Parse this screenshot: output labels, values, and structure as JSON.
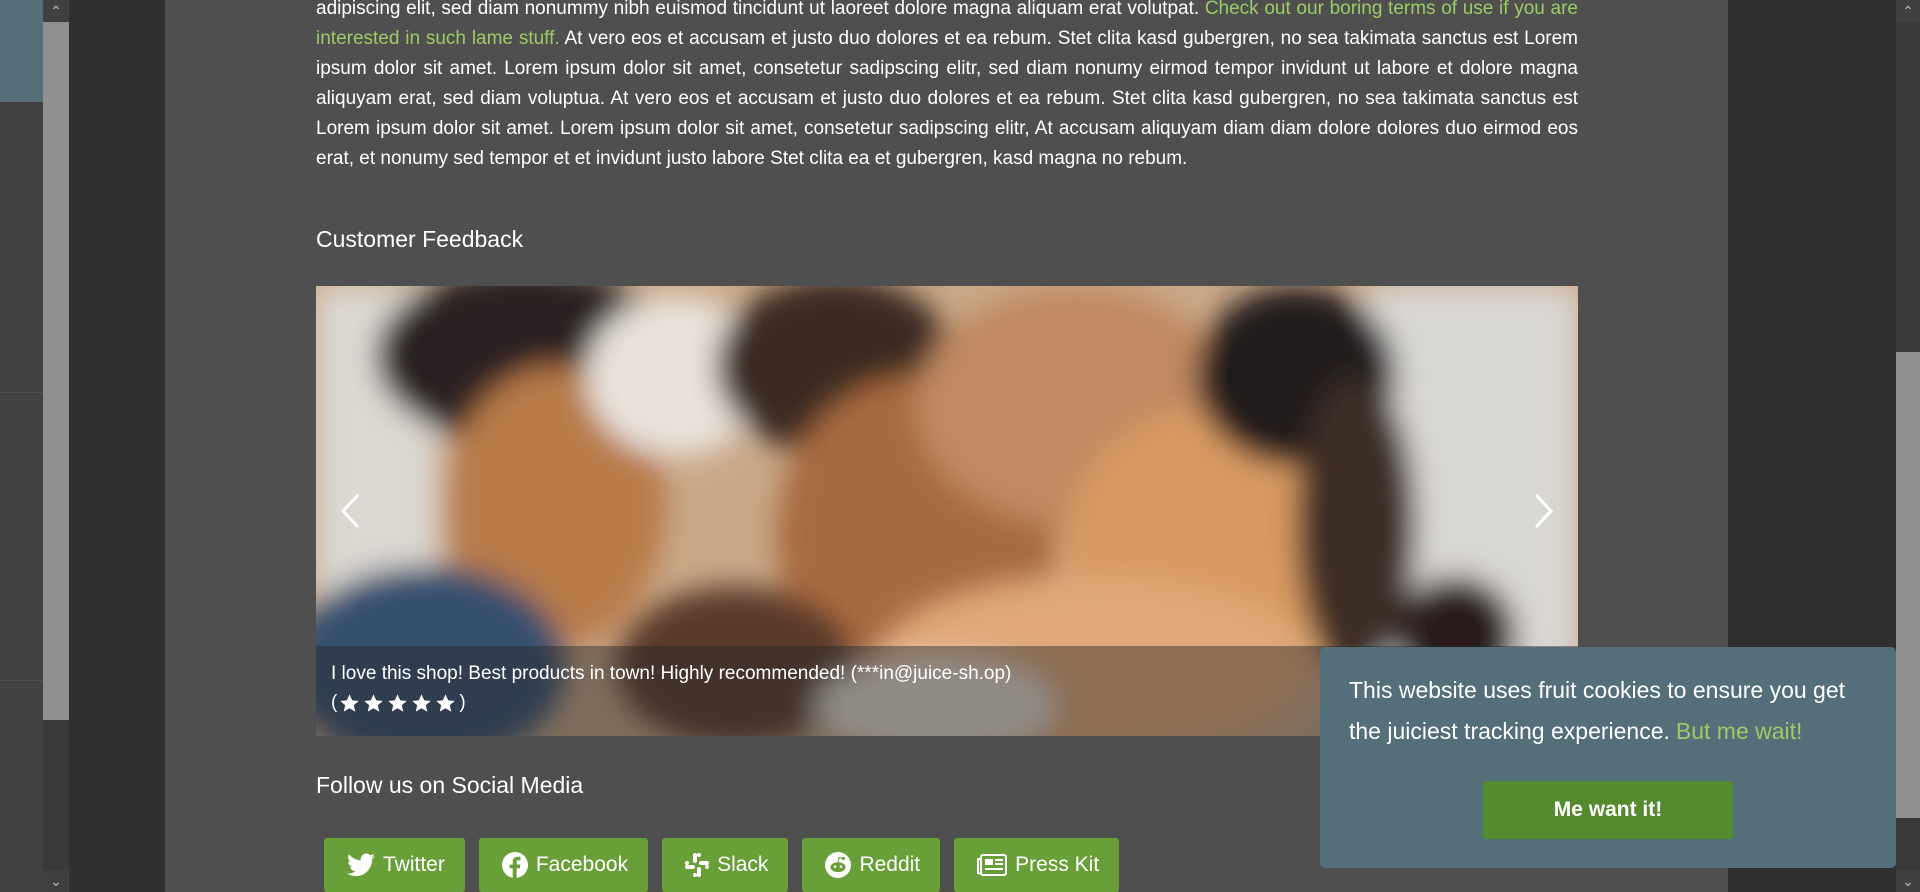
{
  "about": {
    "paragraph_start": "adipiscing elit, sed diam nonummy nibh euismod tincidunt ut laoreet dolore magna aliquam erat volutpat.",
    "terms_link": "Check out our boring terms of use if you are interested in such lame stuff.",
    "paragraph_end": "At vero eos et accusam et justo duo dolores et ea rebum. Stet clita kasd gubergren, no sea takimata sanctus est Lorem ipsum dolor sit amet. Lorem ipsum dolor sit amet, consetetur sadipscing elitr, sed diam nonumy eirmod tempor invidunt ut labore et dolore magna aliquyam erat, sed diam voluptua. At vero eos et accusam et justo duo dolores et ea rebum. Stet clita kasd gubergren, no sea takimata sanctus est Lorem ipsum dolor sit amet. Lorem ipsum dolor sit amet, consetetur sadipscing elitr, At accusam aliquyam diam diam dolore dolores duo eirmod eos erat, et nonumy sed tempor et et invidunt justo labore Stet clita ea et gubergren, kasd magna no rebum."
  },
  "feedback": {
    "title": "Customer Feedback",
    "caption": "I love this shop! Best products in town! Highly recommended! (***in@juice-sh.op)",
    "rating_open": "(",
    "rating_close": ")",
    "rating_stars": 5,
    "prev_icon": "chevron-left-icon",
    "next_icon": "chevron-right-icon"
  },
  "social": {
    "title": "Follow us on Social Media",
    "buttons": [
      {
        "label": "Twitter",
        "icon": "twitter-icon"
      },
      {
        "label": "Facebook",
        "icon": "facebook-icon"
      },
      {
        "label": "Slack",
        "icon": "slack-icon"
      },
      {
        "label": "Reddit",
        "icon": "reddit-icon"
      },
      {
        "label": "Press Kit",
        "icon": "newspaper-icon"
      }
    ]
  },
  "cookie": {
    "message": "This website uses fruit cookies to ensure you get the juiciest tracking experience.",
    "learn_more": "But me wait!",
    "accept": "Me want it!"
  },
  "colors": {
    "accent": "#689f38",
    "link": "#9ccc65",
    "cookie_bg": "#546e7a",
    "card_bg": "#4f4f4f"
  }
}
